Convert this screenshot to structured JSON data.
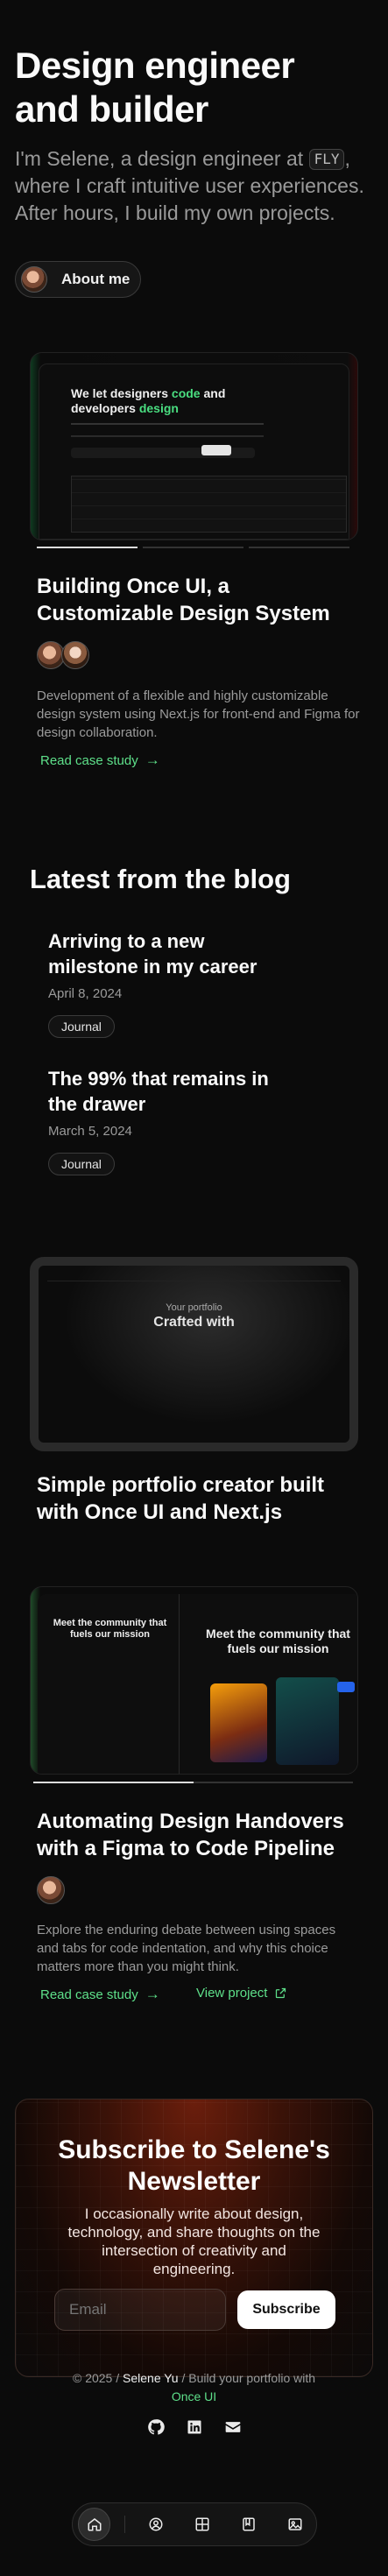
{
  "hero": {
    "title": "Design engineer and builder",
    "intro_prefix": "I'm Selene, a design engineer at ",
    "company_tag": "FLY",
    "intro_suffix": ", where I craft intuitive user experiences. After hours, I build my own projects.",
    "about_label": "About me"
  },
  "projects": [
    {
      "title": "Building Once UI, a Customizable Design System",
      "description": "Development of a flexible and highly customizable design system using Next.js for front-end and Figma for design collaboration.",
      "link_label": "Read case study",
      "screenshot_headline_a": "We let designers ",
      "screenshot_headline_b": "code",
      "screenshot_headline_c": " and developers ",
      "screenshot_headline_d": "design"
    },
    {
      "title": "Simple portfolio creator built with Once UI and Next.js",
      "screenshot_small": "Your portfolio",
      "screenshot_big": "Crafted with"
    },
    {
      "title": "Automating Design Handovers with a Figma to Code Pipeline",
      "description": "Explore the enduring debate between using spaces and tabs for code indentation, and why this choice matters more than you might think.",
      "link_label": "Read case study",
      "link2_label": "View project",
      "screenshot_left": "Meet the community that fuels our mission",
      "screenshot_right": "Meet the community that fuels our mission"
    }
  ],
  "blog": {
    "heading": "Latest from the blog",
    "posts": [
      {
        "title": "Arriving to a new milestone in my career",
        "date": "April 8, 2024",
        "tag": "Journal"
      },
      {
        "title": "The 99% that remains in the drawer",
        "date": "March 5, 2024",
        "tag": "Journal"
      }
    ]
  },
  "newsletter": {
    "title": "Subscribe to Selene's Newsletter",
    "subtitle": "I occasionally write about design, technology, and share thoughts on the intersection of creativity and engineering.",
    "email_placeholder": "Email",
    "button_label": "Subscribe"
  },
  "footer": {
    "copyright": "© 2025 / ",
    "name": "Selene Yu",
    "middle": " / Build your portfolio with ",
    "product": "Once UI"
  },
  "icons": {
    "socials": [
      "github-icon",
      "linkedin-icon",
      "email-icon"
    ],
    "dock": [
      "home-icon",
      "person-icon",
      "grid-icon",
      "book-icon",
      "gallery-icon"
    ]
  },
  "colors": {
    "accent": "#5ee08a",
    "background": "#0b0b0b",
    "newsletter_glow": "#6b1e0c"
  }
}
